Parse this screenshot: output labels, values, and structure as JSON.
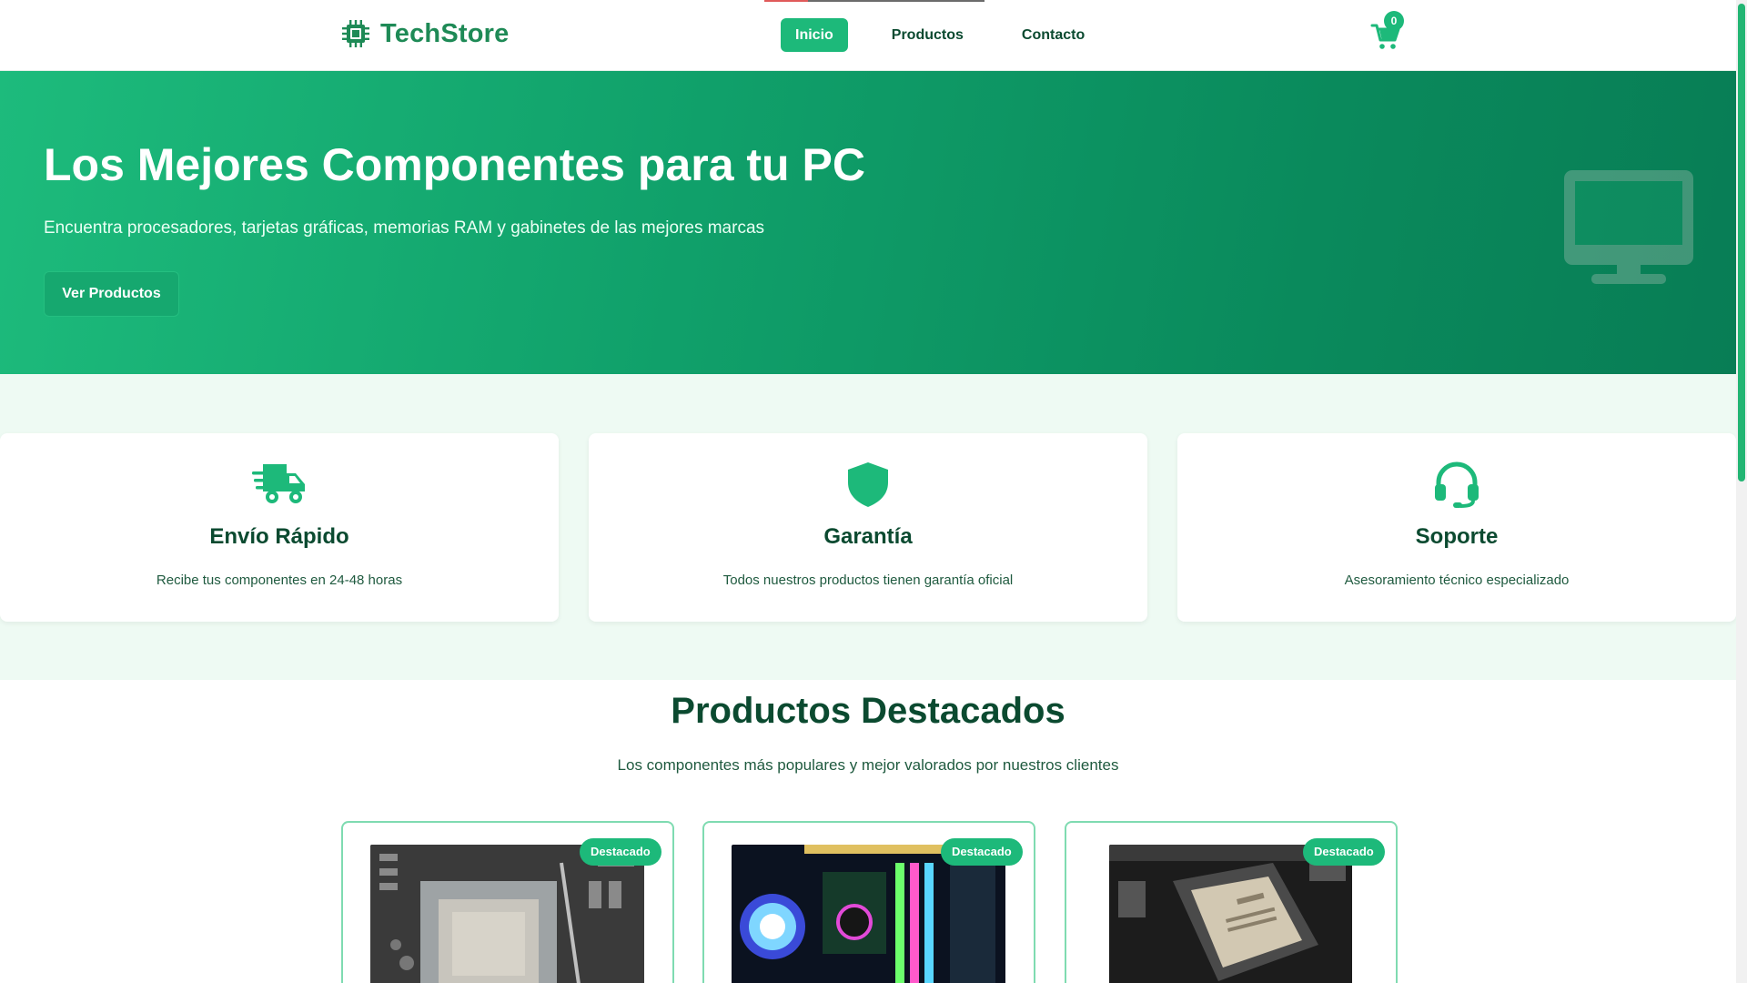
{
  "header": {
    "logo_text": "TechStore",
    "nav": [
      {
        "label": "Inicio",
        "active": true
      },
      {
        "label": "Productos",
        "active": false
      },
      {
        "label": "Contacto",
        "active": false
      }
    ],
    "cart_count": "0",
    "cart_icon": "shopping-cart-icon"
  },
  "hero": {
    "title": "Los Mejores Componentes para tu PC",
    "subtitle": "Encuentra procesadores, tarjetas gráficas, memorias RAM y gabinetes de las mejores marcas",
    "button_label": "Ver Productos",
    "illustration_icon": "desktop-monitor-icon"
  },
  "features": [
    {
      "icon": "fast-truck-icon",
      "title": "Envío Rápido",
      "text": "Recibe tus componentes en 24-48 horas"
    },
    {
      "icon": "shield-icon",
      "title": "Garantía",
      "text": "Todos nuestros productos tienen garantía oficial"
    },
    {
      "icon": "headset-icon",
      "title": "Soporte",
      "text": "Asesoramiento técnico especializado"
    }
  ],
  "products": {
    "title": "Productos Destacados",
    "subtitle": "Los componentes más populares y mejor valorados por nuestros clientes",
    "items": [
      {
        "badge": "Destacado",
        "image": "intel-cpu-socket-photo"
      },
      {
        "badge": "Destacado",
        "image": "rgb-pc-build-photo"
      },
      {
        "badge": "Destacado",
        "image": "amd-ryzen-cpu-photo"
      }
    ]
  },
  "colors": {
    "brand": "#1db97a",
    "brand_dark": "#0b4a30",
    "logo": "#1e8a56",
    "hero_start": "#1dbb7c",
    "hero_end": "#087d55",
    "section_bg": "#eefaf3"
  }
}
